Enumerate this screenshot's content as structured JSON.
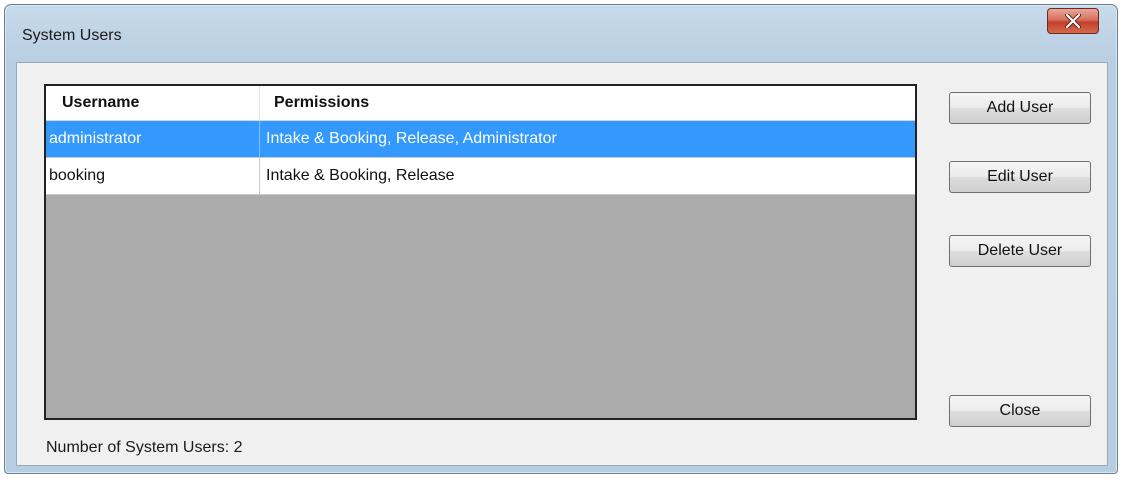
{
  "window": {
    "title": "System Users",
    "close_glyph": "X"
  },
  "table": {
    "columns": [
      "Username",
      "Permissions"
    ],
    "rows": [
      {
        "username": "administrator",
        "permissions": "Intake & Booking, Release, Administrator",
        "selected": true
      },
      {
        "username": "booking",
        "permissions": "Intake & Booking, Release",
        "selected": false
      }
    ]
  },
  "buttons": {
    "add_user": "Add User",
    "edit_user": "Edit User",
    "delete_user": "Delete User",
    "close": "Close"
  },
  "status": {
    "text": "Number of System Users: 2"
  },
  "colors": {
    "selection": "#3399ff",
    "list_background": "#ababab",
    "client_background": "#f0f0f0"
  },
  "icons": {
    "close": "close-icon"
  }
}
